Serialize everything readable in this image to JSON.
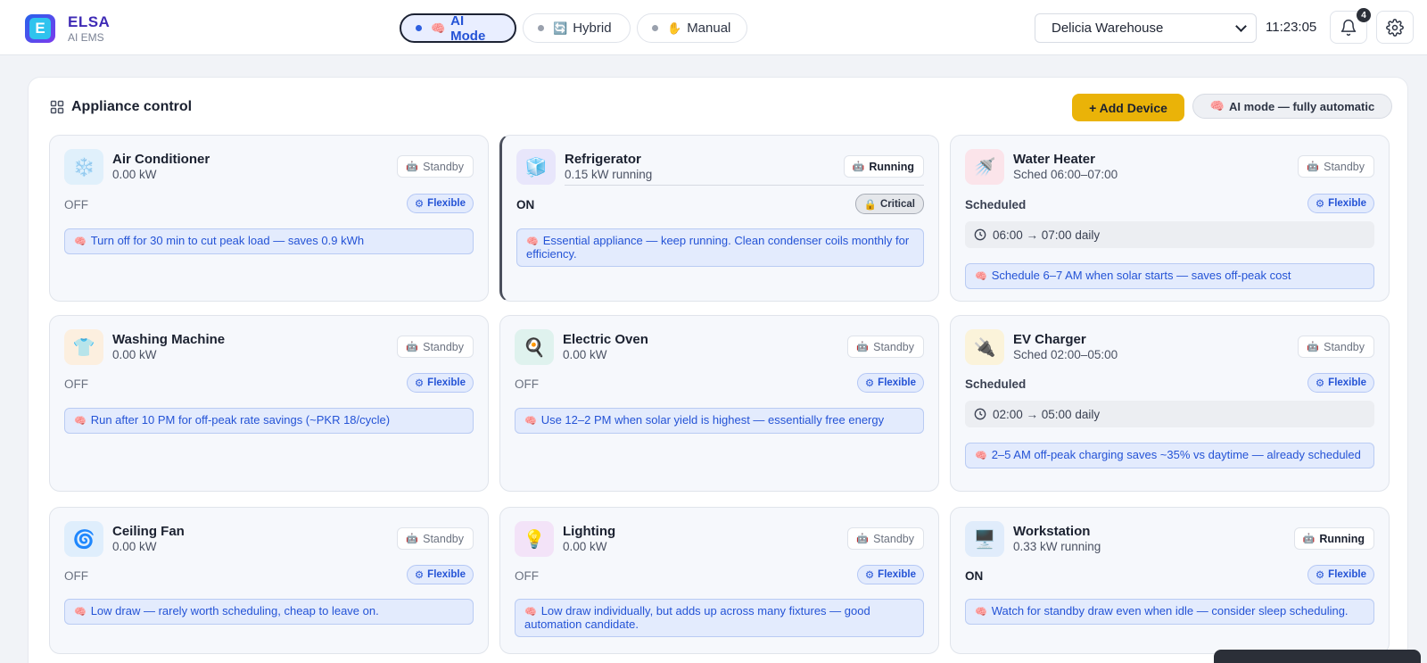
{
  "brand": {
    "name": "ELSA",
    "subtitle": "AI EMS",
    "logo_letter": "E"
  },
  "modes": [
    {
      "label": "AI Mode",
      "emoji": "🧠",
      "active": true
    },
    {
      "label": "Hybrid",
      "emoji": "🔄",
      "active": false
    },
    {
      "label": "Manual",
      "emoji": "✋",
      "active": false
    }
  ],
  "site_select": {
    "value": "Delicia Warehouse"
  },
  "clock": "11:23:05",
  "notifications": {
    "count": "4"
  },
  "panel": {
    "title": "Appliance control",
    "add_button": "+ Add Device",
    "ai_chip": "AI mode — fully automatic",
    "ai_chip_emoji": "🧠"
  },
  "devices": [
    {
      "name": "Air Conditioner",
      "sub": "0.00 kW",
      "icon": "snowflake-icon",
      "emoji": "❄️",
      "state": "Standby",
      "status": "OFF",
      "tag": "Flexible",
      "tip": "Turn off for 30 min to cut peak load — saves 0.9 kWh"
    },
    {
      "name": "Refrigerator",
      "sub": "0.15 kW running",
      "icon": "ice-cube-icon",
      "emoji": "🧊",
      "state": "Running",
      "status": "ON",
      "tag": "Critical",
      "tip": "Essential appliance — keep running. Clean condenser coils monthly for efficiency."
    },
    {
      "name": "Water Heater",
      "sub": "Sched 06:00–07:00",
      "icon": "shower-icon",
      "emoji": "🚿",
      "state": "Standby",
      "status": "Scheduled",
      "tag": "Flexible",
      "schedule": "06:00 → 07:00 daily",
      "tip": "Schedule 6–7 AM when solar starts — saves off-peak cost"
    },
    {
      "name": "Washing Machine",
      "sub": "0.00 kW",
      "icon": "shirt-icon",
      "emoji": "👕",
      "state": "Standby",
      "status": "OFF",
      "tag": "Flexible",
      "tip": "Run after 10 PM for off-peak rate savings (~PKR 18/cycle)"
    },
    {
      "name": "Electric Oven",
      "sub": "0.00 kW",
      "icon": "pan-icon",
      "emoji": "🍳",
      "state": "Standby",
      "status": "OFF",
      "tag": "Flexible",
      "tip": "Use 12–2 PM when solar yield is highest — essentially free energy"
    },
    {
      "name": "EV Charger",
      "sub": "Sched 02:00–05:00",
      "icon": "plug-icon",
      "emoji": "🔌",
      "state": "Standby",
      "status": "Scheduled",
      "tag": "Flexible",
      "schedule": "02:00 → 05:00 daily",
      "tip": "2–5 AM off-peak charging saves ~35% vs daytime — already scheduled"
    },
    {
      "name": "Ceiling Fan",
      "sub": "0.00 kW",
      "icon": "fan-icon",
      "emoji": "🌀",
      "state": "Standby",
      "status": "OFF",
      "tag": "Flexible",
      "tip": "Low draw — rarely worth scheduling, cheap to leave on."
    },
    {
      "name": "Lighting",
      "sub": "0.00 kW",
      "icon": "lightbulb-icon",
      "emoji": "💡",
      "state": "Standby",
      "status": "OFF",
      "tag": "Flexible",
      "tip": "Low draw individually, but adds up across many fixtures — good automation candidate."
    },
    {
      "name": "Workstation",
      "sub": "0.33 kW running",
      "icon": "monitor-icon",
      "emoji": "🖥️",
      "state": "Running",
      "status": "ON",
      "tag": "Flexible",
      "tip": "Watch for standby draw even when idle — consider sleep scheduling."
    }
  ],
  "icons": {
    "robot": "🤖",
    "brain": "🧠",
    "lock": "🔒",
    "flex": "⚙"
  },
  "colors": {
    "accent": "#2453d6",
    "add_button": "#eab308",
    "brand": "#3f2bb5"
  }
}
